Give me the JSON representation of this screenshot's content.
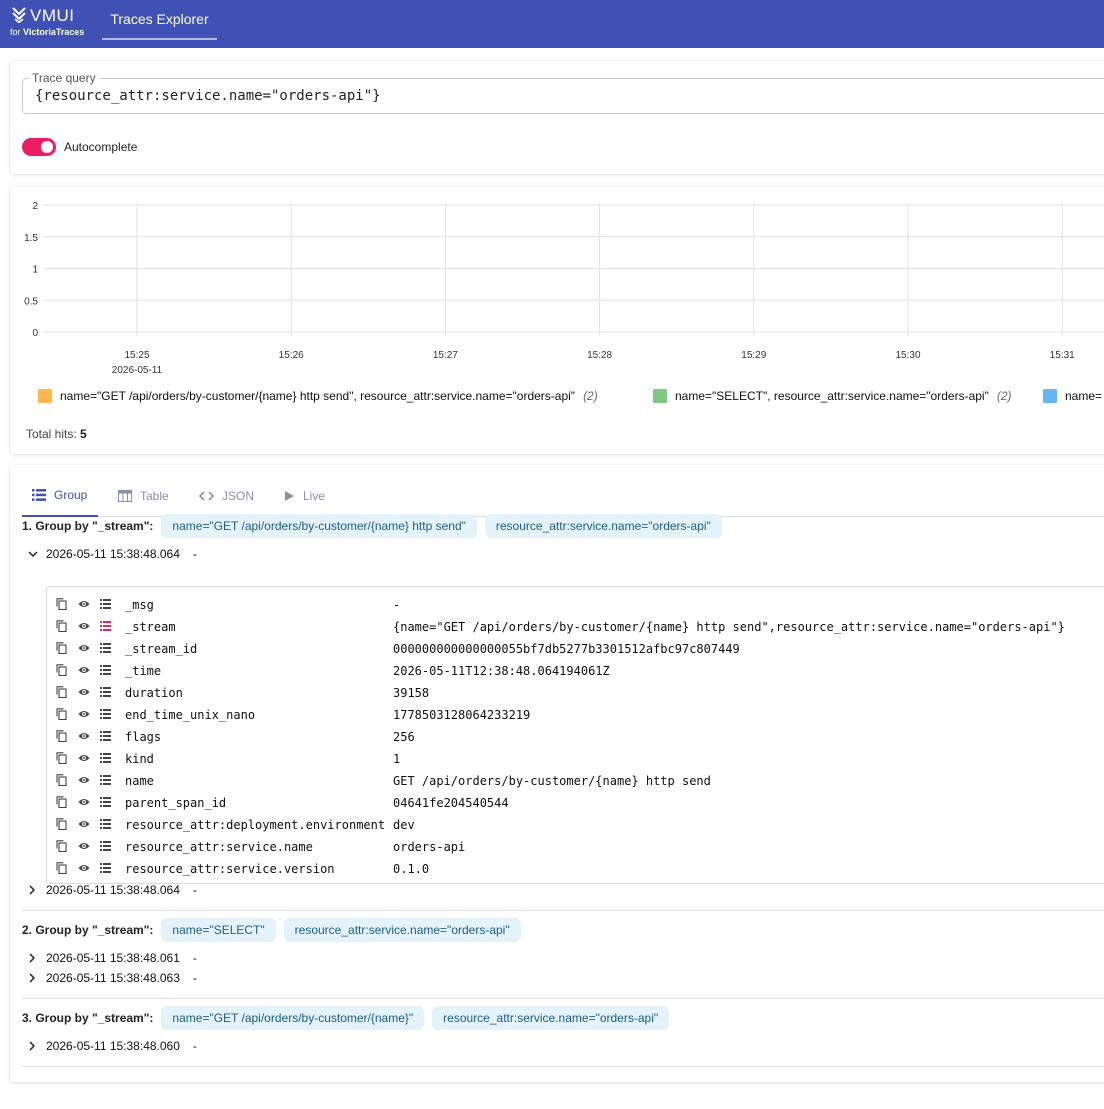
{
  "header": {
    "logo_brand": "VMUI",
    "logo_sub_prefix": "for ",
    "logo_sub_brand": "VictoriaTraces",
    "nav_tab": "Traces Explorer",
    "bg_color": "#3f51b5"
  },
  "query": {
    "label": "Trace query",
    "value": "{resource_attr:service.name=\"orders-api\"}",
    "autocomplete_label": "Autocomplete",
    "autocomplete_on": true
  },
  "chart_data": {
    "type": "line",
    "ylim": [
      0,
      2
    ],
    "y_ticks": [
      "2",
      "1.5",
      "1",
      "0.5",
      "0"
    ],
    "x_ticks": [
      "15:25",
      "15:26",
      "15:27",
      "15:28",
      "15:29",
      "15:30",
      "15:31"
    ],
    "x_sub_label": "2026-05-11",
    "grid": true,
    "legend_position": "bottom",
    "series": [
      {
        "name": "name=\"GET /api/orders/by-customer/{name} http send\", resource_attr:service.name=\"orders-api\"",
        "count": "(2)",
        "color": "#ffb74d"
      },
      {
        "name": "name=\"SELECT\", resource_attr:service.name=\"orders-api\"",
        "count": "(2)",
        "color": "#81c784"
      },
      {
        "name": "name=",
        "count": "",
        "color": "#64b5f6"
      }
    ]
  },
  "totals": {
    "label": "Total hits:",
    "value": "5"
  },
  "tabs": [
    {
      "label": "Group",
      "icon": "list-icon",
      "active": true
    },
    {
      "label": "Table",
      "icon": "table-icon",
      "active": false
    },
    {
      "label": "JSON",
      "icon": "code-icon",
      "active": false
    },
    {
      "label": "Live",
      "icon": "play-icon",
      "active": false
    }
  ],
  "groups": [
    {
      "title": "1. Group by \"_stream\":",
      "chips": [
        "name=\"GET /api/orders/by-customer/{name} http send\"",
        "resource_attr:service.name=\"orders-api\""
      ],
      "rows": [
        {
          "time": "2026-05-11 15:38:48.064",
          "dash": "-",
          "expanded": true
        },
        {
          "time": "2026-05-11 15:38:48.064",
          "dash": "-",
          "expanded": false
        }
      ]
    },
    {
      "title": "2. Group by \"_stream\":",
      "chips": [
        "name=\"SELECT\"",
        "resource_attr:service.name=\"orders-api\""
      ],
      "rows": [
        {
          "time": "2026-05-11 15:38:48.061",
          "dash": "-",
          "expanded": false
        },
        {
          "time": "2026-05-11 15:38:48.063",
          "dash": "-",
          "expanded": false
        }
      ]
    },
    {
      "title": "3. Group by \"_stream\":",
      "chips": [
        "name=\"GET /api/orders/by-customer/{name}\"",
        "resource_attr:service.name=\"orders-api\""
      ],
      "rows": [
        {
          "time": "2026-05-11 15:38:48.060",
          "dash": "-",
          "expanded": false
        }
      ]
    }
  ],
  "fields": [
    {
      "key": "_msg",
      "value": "-",
      "stream": false
    },
    {
      "key": "_stream",
      "value": "{name=\"GET /api/orders/by-customer/{name} http send\",resource_attr:service.name=\"orders-api\"}",
      "stream": true
    },
    {
      "key": "_stream_id",
      "value": "000000000000000055bf7db5277b3301512afbc97c807449",
      "stream": false
    },
    {
      "key": "_time",
      "value": "2026-05-11T12:38:48.064194061Z",
      "stream": false
    },
    {
      "key": "duration",
      "value": "39158",
      "stream": false
    },
    {
      "key": "end_time_unix_nano",
      "value": "1778503128064233219",
      "stream": false
    },
    {
      "key": "flags",
      "value": "256",
      "stream": false
    },
    {
      "key": "kind",
      "value": "1",
      "stream": false
    },
    {
      "key": "name",
      "value": "GET /api/orders/by-customer/{name} http send",
      "stream": false
    },
    {
      "key": "parent_span_id",
      "value": "04641fe204540544",
      "stream": false
    },
    {
      "key": "resource_attr:deployment.environment",
      "value": "dev",
      "stream": false
    },
    {
      "key": "resource_attr:service.name",
      "value": "orders-api",
      "stream": false
    },
    {
      "key": "resource_attr:service.version",
      "value": "0.1.0",
      "stream": false
    }
  ],
  "colors": {
    "accent": "#3f51b5",
    "toggle": "#e91e63",
    "stream_icon": "#e91e63"
  }
}
